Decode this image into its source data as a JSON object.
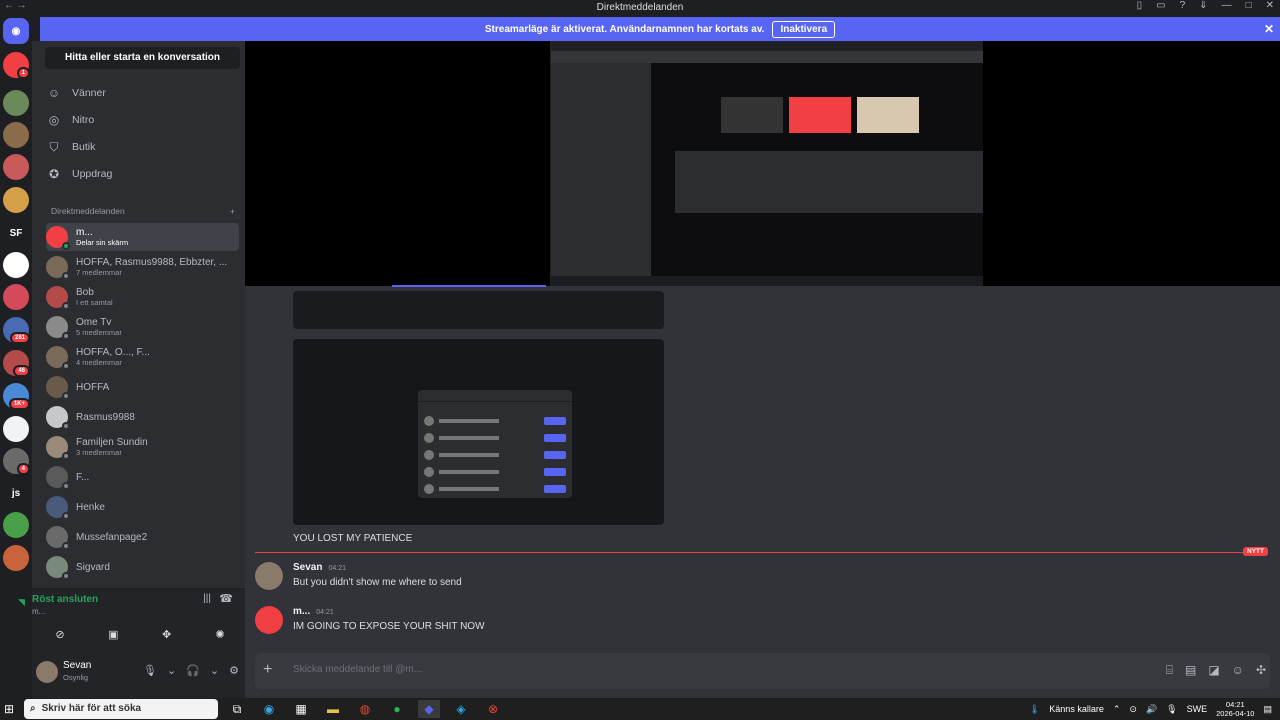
{
  "window": {
    "title": "Direktmeddelanden"
  },
  "banner": {
    "text": "Streamarläge är aktiverat. Användarnamnen har kortats av.",
    "button": "Inaktivera"
  },
  "rail": {
    "servers": [
      {
        "icon": "discord-home-icon",
        "color": "#5865f2"
      },
      {
        "badge": "1",
        "color": "#f23f43"
      },
      {
        "color": "#6b8a5a"
      },
      {
        "color": "#8a6b4a"
      },
      {
        "color": "#c85a5a"
      },
      {
        "color": "#d4a04a"
      },
      {
        "label": "SF",
        "color": "#1e1f22"
      },
      {
        "color": "#ffffff"
      },
      {
        "color": "#d44a5a"
      },
      {
        "badge": "281",
        "color": "#4a6ab4"
      },
      {
        "badge": "46",
        "color": "#b44a4a"
      },
      {
        "badge": "1K+",
        "color": "#4a8ad4"
      },
      {
        "color": "#f2f3f5"
      },
      {
        "badge": "4",
        "color": "#6a6a6a"
      },
      {
        "label": "js",
        "color": "#1e1f22"
      },
      {
        "color": "#4aa04a"
      },
      {
        "color": "#c8643c"
      }
    ]
  },
  "sidebar": {
    "search": "Hitta eller starta en konversation",
    "nav": [
      {
        "label": "Vänner",
        "icon": "friends-icon"
      },
      {
        "label": "Nitro",
        "icon": "nitro-icon"
      },
      {
        "label": "Butik",
        "icon": "shop-icon"
      },
      {
        "label": "Uppdrag",
        "icon": "quests-icon"
      }
    ],
    "dm_header": "Direktmeddelanden",
    "dms": [
      {
        "name": "m...",
        "sub": "Delar sin skärm",
        "active": true,
        "color": "#f23f43"
      },
      {
        "name": "HOFFA, Rasmus9988, Ebbzter, ...",
        "sub": "7 medlemmar",
        "color": "#7a6a5a"
      },
      {
        "name": "Bob",
        "sub": "I ett samtal",
        "color": "#b44a4a"
      },
      {
        "name": "Ome Tv",
        "sub": "5 medlemmar",
        "color": "#8a8a8a"
      },
      {
        "name": "HOFFA, O..., F...",
        "sub": "4 medlemmar",
        "color": "#7a6a5a"
      },
      {
        "name": "HOFFA",
        "sub": "",
        "color": "#6a5a4a"
      },
      {
        "name": "Rasmus9988",
        "sub": "",
        "color": "#c8c8c8"
      },
      {
        "name": "Familjen Sundin",
        "sub": "3 medlemmar",
        "color": "#9a8a7a"
      },
      {
        "name": "F...",
        "sub": "",
        "color": "#5a5a5a"
      },
      {
        "name": "Henke",
        "sub": "",
        "color": "#4a5a7a"
      },
      {
        "name": "Mussefanpage2",
        "sub": "",
        "color": "#6a6a6a"
      },
      {
        "name": "Sigvard",
        "sub": "",
        "color": "#7a8a7a"
      }
    ],
    "voice": {
      "label": "Röst ansluten",
      "sub": "m..."
    },
    "user": {
      "name": "Sevan",
      "status": "Osynlig"
    }
  },
  "main": {
    "message_text": "YOU LOST MY PATIENCE",
    "new_badge": "NYTT",
    "messages": [
      {
        "author": "Sevan",
        "time": "04:21",
        "body": "But you didn't show me where to send",
        "color": "#8a7a6a"
      },
      {
        "author": "m...",
        "time": "04:21",
        "body": "IM GOING TO EXPOSE YOUR SHIT NOW",
        "color": "#f23f43"
      }
    ],
    "composer_placeholder": "Skicka meddelande till @m..."
  },
  "taskbar": {
    "search_placeholder": "Skriv här för att söka",
    "weather": "Känns kallare",
    "lang": "SWE",
    "time": "04:21",
    "date": "2026-04-10"
  }
}
